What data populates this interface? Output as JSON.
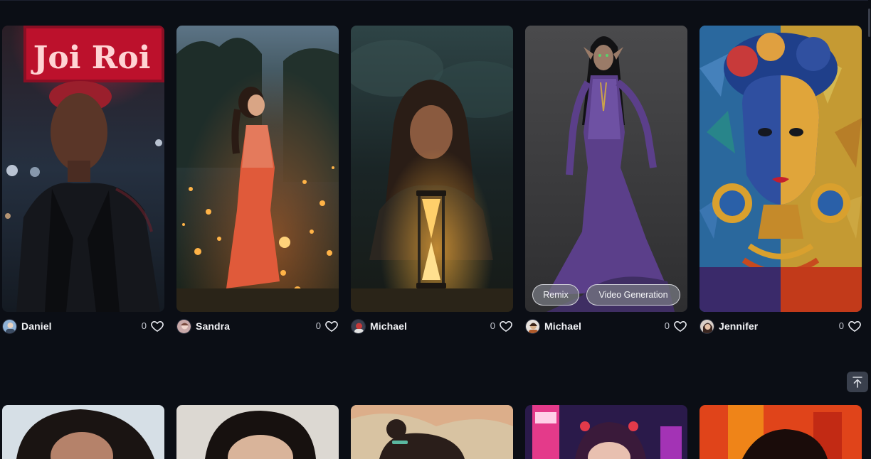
{
  "feed": {
    "row1": [
      {
        "author": "Daniel",
        "likes": "0",
        "image": "neon-sign-portrait"
      },
      {
        "author": "Sandra",
        "likes": "0",
        "image": "firefly-meadow-woman"
      },
      {
        "author": "Michael",
        "likes": "0",
        "image": "hourglass-woman"
      },
      {
        "author": "Michael",
        "likes": "0",
        "image": "purple-elf-gown"
      },
      {
        "author": "Jennifer",
        "likes": "0",
        "image": "mosaic-portrait"
      }
    ],
    "hover_actions": {
      "remix": "Remix",
      "video": "Video Generation"
    }
  },
  "icons": {
    "heart": "heart-icon",
    "back_to_top": "arrow-up-to-line-icon"
  }
}
